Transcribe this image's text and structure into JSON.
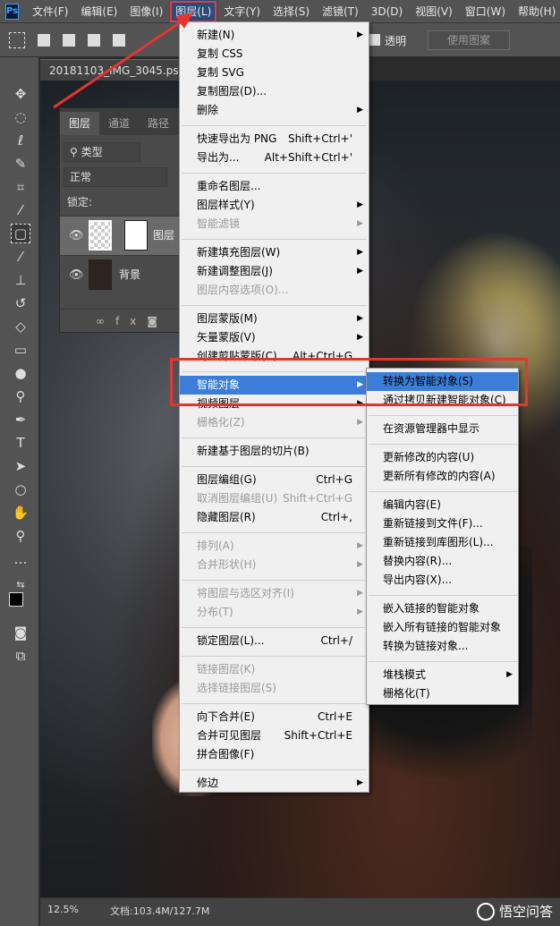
{
  "app": {
    "logo": "Ps"
  },
  "menubar": {
    "items": [
      "文件(F)",
      "编辑(E)",
      "图像(I)",
      "图层(L)",
      "文字(Y)",
      "选择(S)",
      "滤镜(T)",
      "3D(D)",
      "视图(V)",
      "窗口(W)",
      "帮助(H)"
    ],
    "active_index": 3
  },
  "options_bar": {
    "transparent_label": "透明",
    "use_pattern_label": "使用图案"
  },
  "document": {
    "tab_title": "20181103_IMG_3045.psd"
  },
  "layers_panel": {
    "tabs": [
      "图层",
      "通道",
      "路径"
    ],
    "filter_label": "类型",
    "blend_mode": "正常",
    "lock_label": "锁定:",
    "layers": [
      {
        "name": "图层",
        "selected": true
      },
      {
        "name": "背景",
        "selected": false
      }
    ],
    "footer_icons": [
      "link-icon",
      "fx-icon",
      "mask-icon",
      "adjustment-icon"
    ]
  },
  "status": {
    "zoom": "12.5%",
    "doc_size": "文档:103.4M/127.7M"
  },
  "watermark": "悟空问答",
  "layer_menu": [
    {
      "label": "新建(N)",
      "submenu": true,
      "sep_before": false
    },
    {
      "label": "复制 CSS"
    },
    {
      "label": "复制 SVG"
    },
    {
      "label": "复制图层(D)..."
    },
    {
      "label": "删除",
      "submenu": true
    },
    {
      "label": "快速导出为 PNG",
      "shortcut": "Shift+Ctrl+'",
      "sep_before": true
    },
    {
      "label": "导出为...",
      "shortcut": "Alt+Shift+Ctrl+'"
    },
    {
      "label": "重命名图层...",
      "sep_before": true
    },
    {
      "label": "图层样式(Y)",
      "submenu": true
    },
    {
      "label": "智能滤镜",
      "submenu": true,
      "disabled": true
    },
    {
      "label": "新建填充图层(W)",
      "submenu": true,
      "sep_before": true
    },
    {
      "label": "新建调整图层(J)",
      "submenu": true
    },
    {
      "label": "图层内容选项(O)...",
      "disabled": true
    },
    {
      "label": "图层蒙版(M)",
      "submenu": true,
      "sep_before": true
    },
    {
      "label": "矢量蒙版(V)",
      "submenu": true
    },
    {
      "label": "创建剪贴蒙版(C)",
      "shortcut": "Alt+Ctrl+G"
    },
    {
      "label": "智能对象",
      "submenu": true,
      "highlighted": true,
      "sep_before": true
    },
    {
      "label": "视频图层",
      "submenu": true
    },
    {
      "label": "栅格化(Z)",
      "submenu": true,
      "disabled": true
    },
    {
      "label": "新建基于图层的切片(B)",
      "sep_before": true
    },
    {
      "label": "图层编组(G)",
      "shortcut": "Ctrl+G",
      "sep_before": true
    },
    {
      "label": "取消图层编组(U)",
      "shortcut": "Shift+Ctrl+G",
      "disabled": true
    },
    {
      "label": "隐藏图层(R)",
      "shortcut": "Ctrl+,"
    },
    {
      "label": "排列(A)",
      "submenu": true,
      "disabled": true,
      "sep_before": true
    },
    {
      "label": "合并形状(H)",
      "submenu": true,
      "disabled": true
    },
    {
      "label": "将图层与选区对齐(I)",
      "submenu": true,
      "disabled": true,
      "sep_before": true
    },
    {
      "label": "分布(T)",
      "submenu": true,
      "disabled": true
    },
    {
      "label": "锁定图层(L)...",
      "shortcut": "Ctrl+/",
      "sep_before": true
    },
    {
      "label": "链接图层(K)",
      "disabled": true,
      "sep_before": true
    },
    {
      "label": "选择链接图层(S)",
      "disabled": true
    },
    {
      "label": "向下合并(E)",
      "shortcut": "Ctrl+E",
      "sep_before": true
    },
    {
      "label": "合并可见图层",
      "shortcut": "Shift+Ctrl+E"
    },
    {
      "label": "拼合图像(F)"
    },
    {
      "label": "修边",
      "submenu": true,
      "sep_before": true
    }
  ],
  "smart_object_submenu": [
    {
      "label": "转换为智能对象(S)",
      "highlighted": true
    },
    {
      "label": "通过拷贝新建智能对象(C)",
      "disabled": true
    },
    {
      "label": "在资源管理器中显示",
      "disabled": true,
      "sep_before": true
    },
    {
      "label": "更新修改的内容(U)",
      "disabled": true,
      "sep_before": true
    },
    {
      "label": "更新所有修改的内容(A)"
    },
    {
      "label": "编辑内容(E)",
      "disabled": true,
      "sep_before": true
    },
    {
      "label": "重新链接到文件(F)...",
      "disabled": true
    },
    {
      "label": "重新链接到库图形(L)...",
      "disabled": true
    },
    {
      "label": "替换内容(R)...",
      "disabled": true
    },
    {
      "label": "导出内容(X)...",
      "disabled": true
    },
    {
      "label": "嵌入链接的智能对象",
      "disabled": true,
      "sep_before": true
    },
    {
      "label": "嵌入所有链接的智能对象"
    },
    {
      "label": "转换为链接对象..."
    },
    {
      "label": "堆栈模式",
      "submenu": true,
      "disabled": true,
      "sep_before": true
    },
    {
      "label": "栅格化(T)",
      "disabled": true
    }
  ],
  "colors": {
    "highlight": "#3b7dd8",
    "annotation_red": "#e6352f"
  }
}
